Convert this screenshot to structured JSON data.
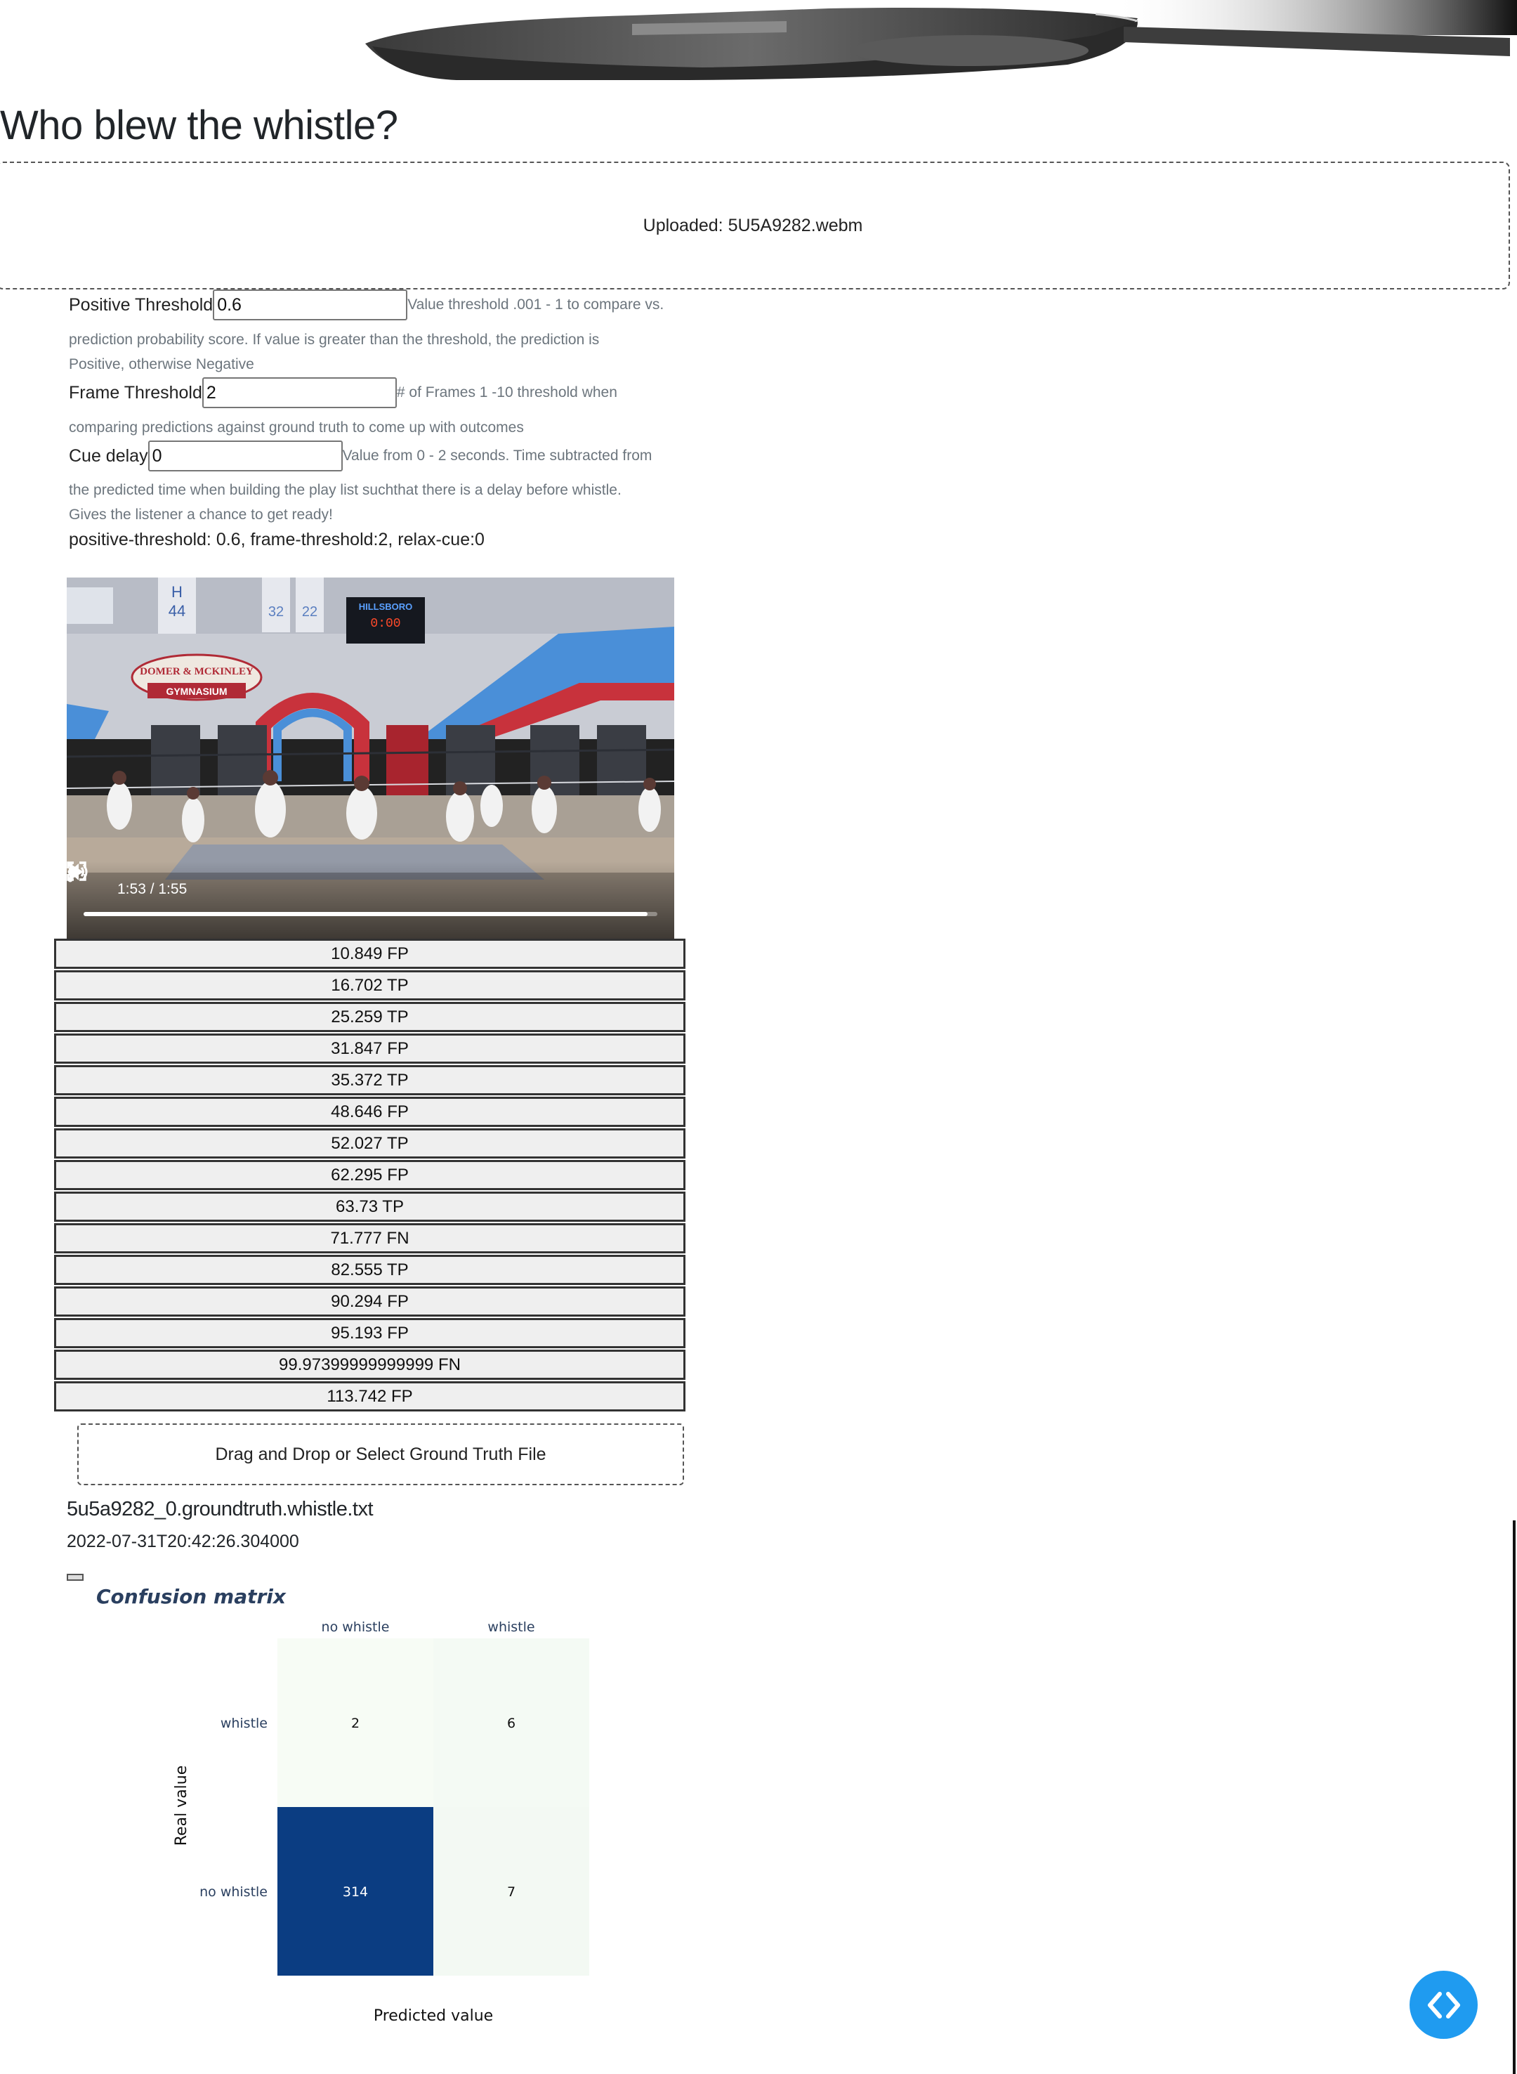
{
  "page": {
    "title": "Who blew the whistle?"
  },
  "upload": {
    "label": "Uploaded: 5U5A9282.webm"
  },
  "form": {
    "positive_threshold": {
      "label": "Positive Threshold",
      "value": "0.6",
      "hint_lines": [
        "Value threshold .001 - 1 to compare vs.",
        "prediction probability score. If value is greater than the threshold, the prediction is",
        "Positive, otherwise Negative"
      ]
    },
    "frame_threshold": {
      "label": "Frame Threshold",
      "value": "2",
      "hint_lines": [
        "# of Frames 1 -10 threshold when",
        "comparing predictions against ground truth to come up with outcomes"
      ]
    },
    "cue_delay": {
      "label": "Cue delay",
      "value": "0",
      "hint_lines": [
        "Value from 0 - 2 seconds. Time subtracted from",
        "the predicted time when building the play list suchthat there is a delay before whistle.",
        "Gives the listener a chance to get ready!"
      ]
    }
  },
  "status_line": "positive-threshold: 0.6, frame-threshold:2, relax-cue:0",
  "video": {
    "time": "1:53 / 1:55",
    "progress": 0.983,
    "scene_text": {
      "gym_sign_top": "DOMER & MCKINLEY",
      "gym_sign_bottom": "GYMNASIUM",
      "scoreboard_brand": "HILLSBORO",
      "clock": "0:00",
      "banner_numbers": [
        "44",
        "32",
        "22"
      ],
      "banner_letter": "H"
    }
  },
  "outcomes": [
    "10.849 FP",
    "16.702 TP",
    "25.259 TP",
    "31.847 FP",
    "35.372 TP",
    "48.646 FP",
    "52.027 TP",
    "62.295 FP",
    "63.73 TP",
    "71.777 FN",
    "82.555 TP",
    "90.294 FP",
    "95.193 FP",
    "99.97399999999999 FN",
    "113.742 FP"
  ],
  "ground_truth": {
    "drop_label": "Drag and Drop or Select Ground Truth File",
    "filename": "5u5a9282_0.groundtruth.whistle.txt",
    "timestamp": "2022-07-31T20:42:26.304000"
  },
  "chart_data": {
    "type": "heatmap",
    "title": "Confusion matrix",
    "xlabel": "Predicted value",
    "ylabel": "Real value",
    "x": [
      "no whistle",
      "whistle"
    ],
    "y": [
      "whistle",
      "no whistle"
    ],
    "z": [
      [
        2,
        6
      ],
      [
        314,
        7
      ]
    ],
    "colorscale": [
      "#f7fcf5",
      "#0b3d82"
    ]
  },
  "colors": {
    "accent": "#1f9bf0",
    "chart_title": "#2a3f5f",
    "hint_text": "#6c757d"
  },
  "icons": {
    "fab": "code-brackets-icon",
    "play": "play-icon",
    "mute": "volume-icon",
    "fullscreen": "fullscreen-icon",
    "more": "more-vertical-icon"
  }
}
